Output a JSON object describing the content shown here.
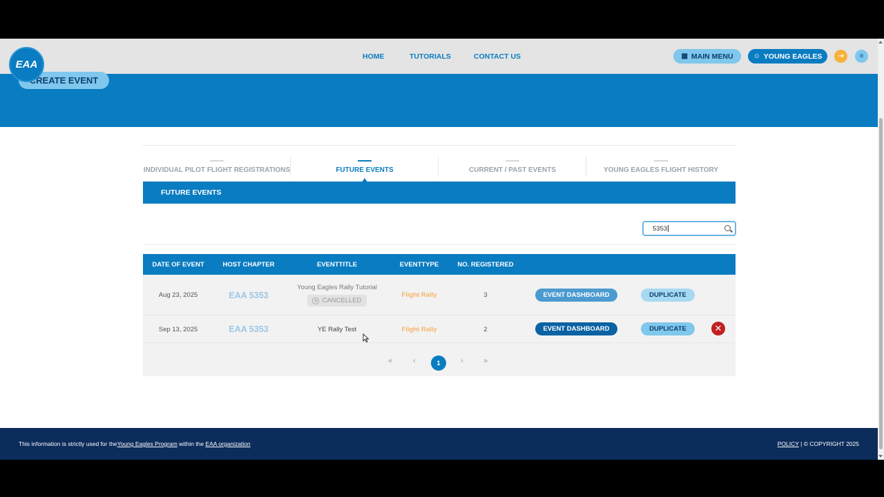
{
  "logo": {
    "text": "EAA"
  },
  "nav": {
    "home": "HOME",
    "tutorials": "TUTORIALS",
    "contact": "CONTACT US"
  },
  "header_buttons": {
    "main_menu": "MAIN MENU",
    "young_eagles": "YOUNG EAGLES"
  },
  "hero": {
    "create_event": "CREATE EVENT"
  },
  "tabs": [
    {
      "label": "INDIVIDUAL PILOT FLIGHT REGISTRATIONS",
      "active": false
    },
    {
      "label": "FUTURE EVENTS",
      "active": true
    },
    {
      "label": "CURRENT / PAST EVENTS",
      "active": false
    },
    {
      "label": "YOUNG EAGLES FLIGHT HISTORY",
      "active": false
    }
  ],
  "section_title": "FUTURE EVENTS",
  "search": {
    "value": "5353"
  },
  "table": {
    "headers": [
      "DATE OF EVENT",
      "HOST CHAPTER",
      "EVENTTITLE",
      "EVENTTYPE",
      "NO. REGISTERED"
    ],
    "rows": [
      {
        "date": "Aug 23, 2025",
        "chapter": "EAA 5353",
        "title": "Young Eagles Rally Tutorial",
        "status": "CANCELLED",
        "type": "Flight Rally",
        "registered": "3",
        "dashboard": "EVENT DASHBOARD",
        "duplicate": "DUPLICATE"
      },
      {
        "date": "Sep 13, 2025",
        "chapter": "EAA 5353",
        "title": "YE Rally Test",
        "type": "Flight Rally",
        "registered": "2",
        "dashboard": "EVENT DASHBOARD",
        "duplicate": "DUPLICATE"
      }
    ]
  },
  "pagination": {
    "first": "«",
    "prev": "‹",
    "current": "1",
    "next": "›",
    "last": "»"
  },
  "footer": {
    "text_prefix": "This information is strictly used for the",
    "program_link": "Young Eagles Program",
    "text_mid": " within the ",
    "org_link": "EAA organization",
    "policy": "POLICY",
    "copyright": " | © COPYRIGHT 2025"
  },
  "colors": {
    "primary": "#0a7cc1",
    "light": "#7fc7ec",
    "footer": "#0c2c5b",
    "danger": "#c21f1f",
    "accent": "#f8b13a"
  }
}
